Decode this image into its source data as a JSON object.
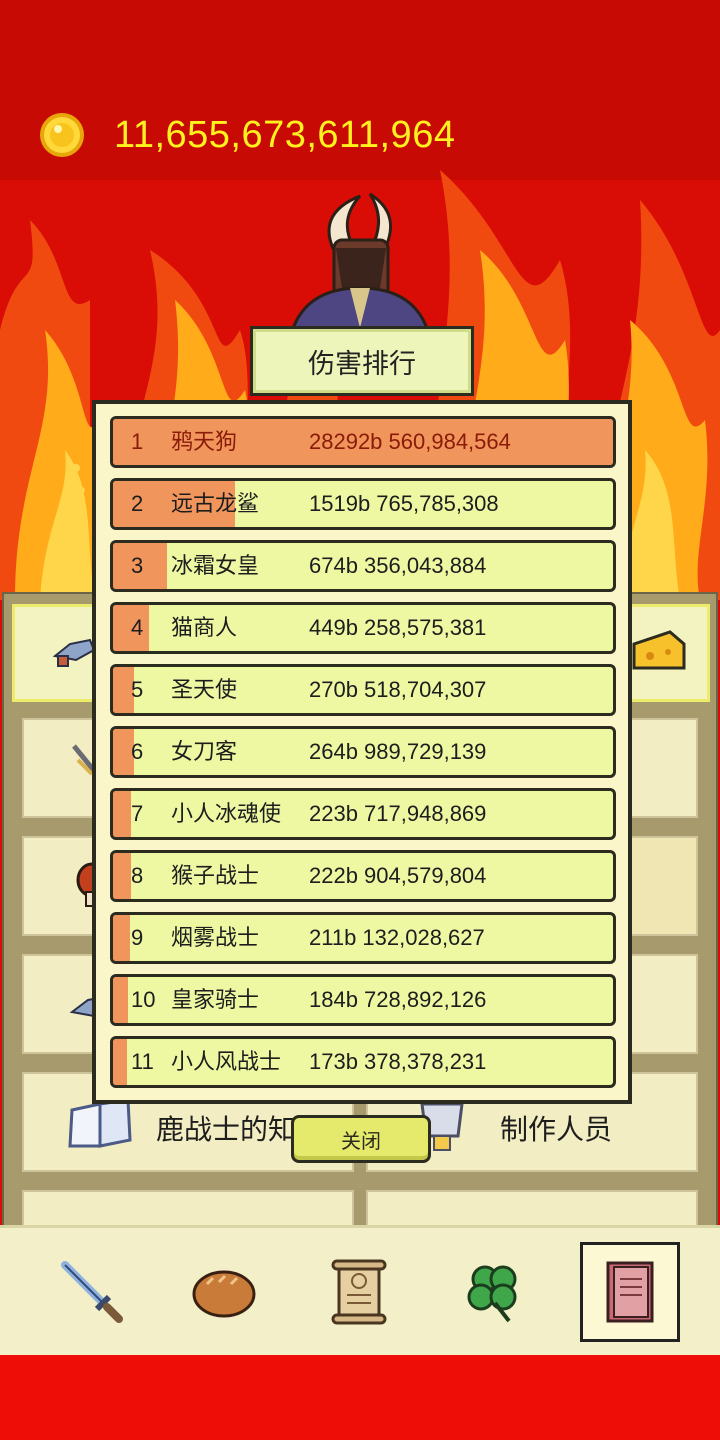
{
  "gold": {
    "amount": "11,655,673,611,964"
  },
  "ranking": {
    "title": "伤害排行",
    "rows": [
      {
        "rank": "1",
        "name": "鸦天狗",
        "damage": "28292b 560,984,564",
        "share": 1.0
      },
      {
        "rank": "2",
        "name": "远古龙鲨",
        "damage": "1519b 765,785,308",
        "share": 0.054
      },
      {
        "rank": "3",
        "name": "冰霜女皇",
        "damage": "674b 356,043,884",
        "share": 0.024
      },
      {
        "rank": "4",
        "name": "猫商人",
        "damage": "449b 258,575,381",
        "share": 0.016
      },
      {
        "rank": "5",
        "name": "圣天使",
        "damage": "270b 518,704,307",
        "share": 0.0095
      },
      {
        "rank": "6",
        "name": "女刀客",
        "damage": "264b 989,729,139",
        "share": 0.0093
      },
      {
        "rank": "7",
        "name": "小人冰魂使",
        "damage": "223b 717,948,869",
        "share": 0.0079
      },
      {
        "rank": "8",
        "name": "猴子战士",
        "damage": "222b 904,579,804",
        "share": 0.0079
      },
      {
        "rank": "9",
        "name": "烟雾战士",
        "damage": "211b 132,028,627",
        "share": 0.0075
      },
      {
        "rank": "10",
        "name": "皇家骑士",
        "damage": "184b 728,892,126",
        "share": 0.0065
      },
      {
        "rank": "11",
        "name": "小人风战士",
        "damage": "173b 378,378,231",
        "share": 0.0061
      }
    ],
    "close_label": "关闭"
  },
  "menu": {
    "book_label": "鹿战士的知识",
    "credits_label": "制作人员"
  },
  "nav": {
    "items": [
      "sword-icon",
      "bread-icon",
      "scroll-icon",
      "clover-icon",
      "book-icon"
    ],
    "active": "book-icon"
  },
  "colors": {
    "gold": "#fff21e",
    "bg_red": "#d90c06",
    "row_fill": "#eef8a2",
    "bar": "#f0955c"
  }
}
